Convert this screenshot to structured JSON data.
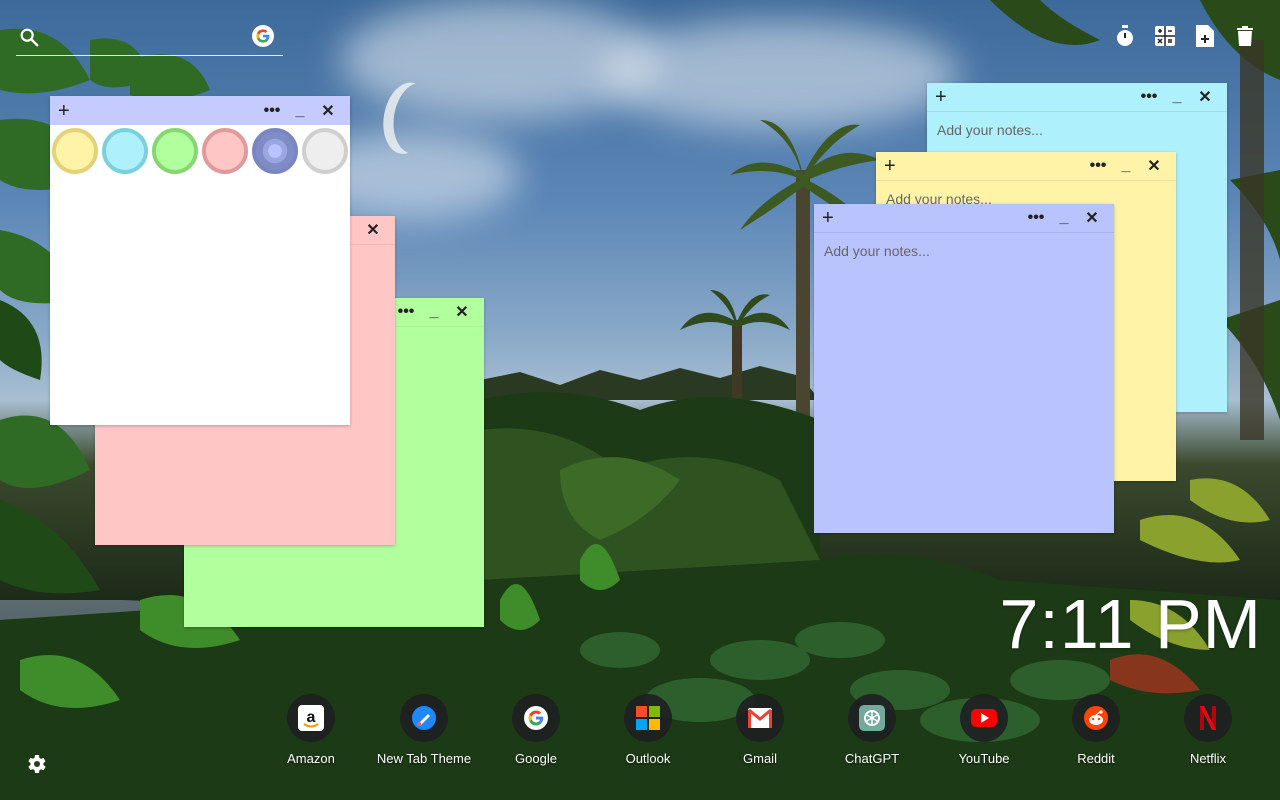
{
  "search": {
    "placeholder": ""
  },
  "toolbar": {
    "items": [
      {
        "icon": "timer-icon"
      },
      {
        "icon": "calculator-icon"
      },
      {
        "icon": "add-note-icon"
      },
      {
        "icon": "trash-icon"
      }
    ]
  },
  "notes": [
    {
      "id": "palette-note",
      "color": "#ffffff",
      "bar_color": "#c5cbff",
      "placeholder": ""
    },
    {
      "id": "pink-note",
      "color": "#ffc6c6",
      "bar_color": "#ffc6c6",
      "placeholder": ""
    },
    {
      "id": "green-note",
      "color": "#b2ff9e",
      "bar_color": "#b2ff9e",
      "placeholder": ""
    },
    {
      "id": "cyan-note",
      "color": "#aef0fb",
      "bar_color": "#aef0fb",
      "placeholder": "Add your notes..."
    },
    {
      "id": "yellow-note",
      "color": "#fff3a8",
      "bar_color": "#fff3a8",
      "placeholder": "Add your notes..."
    },
    {
      "id": "lavender-note",
      "color": "#b9c4ff",
      "bar_color": "#b9c4ff",
      "placeholder": "Add your notes..."
    }
  ],
  "palette": [
    {
      "name": "yellow",
      "fill": "#fff3a8",
      "border": "#e3d27a"
    },
    {
      "name": "cyan",
      "fill": "#aef0fb",
      "border": "#7cd0dc"
    },
    {
      "name": "green",
      "fill": "#b2ff9e",
      "border": "#86d672"
    },
    {
      "name": "pink",
      "fill": "#ffc6c6",
      "border": "#e09a9a"
    },
    {
      "name": "lavender",
      "fill": "#9aa6e0",
      "border": "#7a86c0",
      "selected": true
    },
    {
      "name": "white",
      "fill": "#eeeeee",
      "border": "#cfcfcf"
    }
  ],
  "controls": {
    "plus": "+",
    "more": "•••",
    "minimize": "_",
    "close": "✕"
  },
  "clock": {
    "time": "7:11 PM"
  },
  "shortcuts": [
    {
      "label": "Amazon",
      "icon": "amazon-icon"
    },
    {
      "label": "New Tab Theme",
      "icon": "new-tab-theme-icon"
    },
    {
      "label": "Google",
      "icon": "google-icon"
    },
    {
      "label": "Outlook",
      "icon": "outlook-icon"
    },
    {
      "label": "Gmail",
      "icon": "gmail-icon"
    },
    {
      "label": "ChatGPT",
      "icon": "chatgpt-icon"
    },
    {
      "label": "YouTube",
      "icon": "youtube-icon"
    },
    {
      "label": "Reddit",
      "icon": "reddit-icon"
    },
    {
      "label": "Netflix",
      "icon": "netflix-icon"
    }
  ]
}
